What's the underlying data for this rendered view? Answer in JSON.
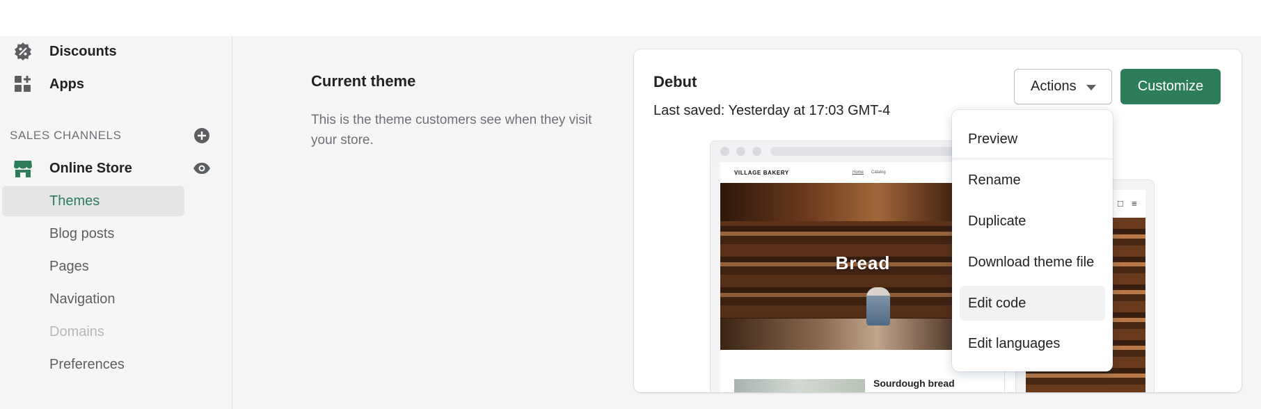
{
  "sidebar": {
    "items": [
      {
        "label": "Discounts",
        "icon": "discount-icon"
      },
      {
        "label": "Apps",
        "icon": "apps-icon"
      }
    ],
    "sales_channels_title": "SALES CHANNELS",
    "channel": {
      "label": "Online Store",
      "icon": "store-icon"
    },
    "sub_items": [
      {
        "label": "Themes",
        "state": "active"
      },
      {
        "label": "Blog posts",
        "state": "normal"
      },
      {
        "label": "Pages",
        "state": "normal"
      },
      {
        "label": "Navigation",
        "state": "normal"
      },
      {
        "label": "Domains",
        "state": "disabled"
      },
      {
        "label": "Preferences",
        "state": "normal"
      }
    ]
  },
  "annotation": {
    "title": "Current theme",
    "description": "This is the theme customers see when they visit your store."
  },
  "theme_card": {
    "name": "Debut",
    "last_saved": "Last saved: Yesterday at 17:03 GMT-4",
    "actions_label": "Actions",
    "customize_label": "Customize",
    "preview": {
      "brand": "VILLAGE BAKERY",
      "nav_home": "Home",
      "nav_catalog": "Catalog",
      "hero_text": "Bread",
      "product_title": "Sourdough bread"
    }
  },
  "actions_menu": {
    "items": [
      "Preview",
      "Rename",
      "Duplicate",
      "Download theme file",
      "Edit code",
      "Edit languages"
    ],
    "hovered": "Edit code"
  },
  "colors": {
    "accent": "#2e7d5a",
    "background": "#f6f6f7",
    "text": "#202223",
    "muted_text": "#6d7175"
  }
}
